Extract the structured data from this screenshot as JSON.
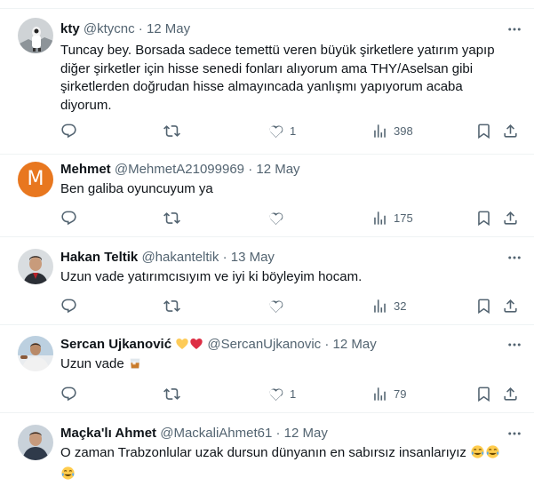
{
  "replies": [
    {
      "display_name": "kty",
      "handle": "@ktycnc",
      "separator": "·",
      "date": "12 May",
      "text": "Tuncay bey. Borsada sadece temettü veren büyük şirketlere yatırım yapıp diğer şirketler için hisse senedi fonları alıyorum ama THY/Aselsan gibi şirketlerden doğrudan hisse almayıncada yanlışmı yapıyorum acaba diyorum.",
      "likes": "1",
      "views": "398"
    },
    {
      "display_name": "Mehmet",
      "avatar_letter": "M",
      "handle": "@MehmetA21099969",
      "separator": "·",
      "date": "12 May",
      "text": "Ben galiba oyuncuyum ya",
      "likes": "",
      "views": "175"
    },
    {
      "display_name": "Hakan Teltik",
      "handle": "@hakanteltik",
      "separator": "·",
      "date": "13 May",
      "text": "Uzun vade yatırımcısıyım ve iyi ki böyleyim hocam.",
      "likes": "",
      "views": "32"
    },
    {
      "display_name": "Sercan Ujkanović",
      "handle": "@SercanUjkanovic",
      "separator": "·",
      "date": "12 May",
      "text": "Uzun vade",
      "likes": "1",
      "views": "79"
    },
    {
      "display_name": "Maçka'lı Ahmet",
      "handle": "@MackaliAhmet61",
      "separator": "·",
      "date": "12 May",
      "text": "O zaman Trabzonlular uzak dursun dünyanın en sabırsız insanlarıyız"
    }
  ],
  "icons": {
    "more": "more-horizontal-icon",
    "reply": "reply-icon",
    "retweet": "retweet-icon",
    "like": "heart-icon",
    "views": "views-bar-chart-icon",
    "bookmark": "bookmark-icon",
    "share": "share-icon",
    "emojis": [
      "yellow-heart-emoji",
      "red-heart-emoji",
      "tumbler-glass-emoji",
      "tears-of-joy-emoji"
    ]
  },
  "colors": {
    "text": "#0f1419",
    "secondary": "#536471",
    "divider": "#eff3f4",
    "avatar_mehmet": "#e8771f"
  }
}
